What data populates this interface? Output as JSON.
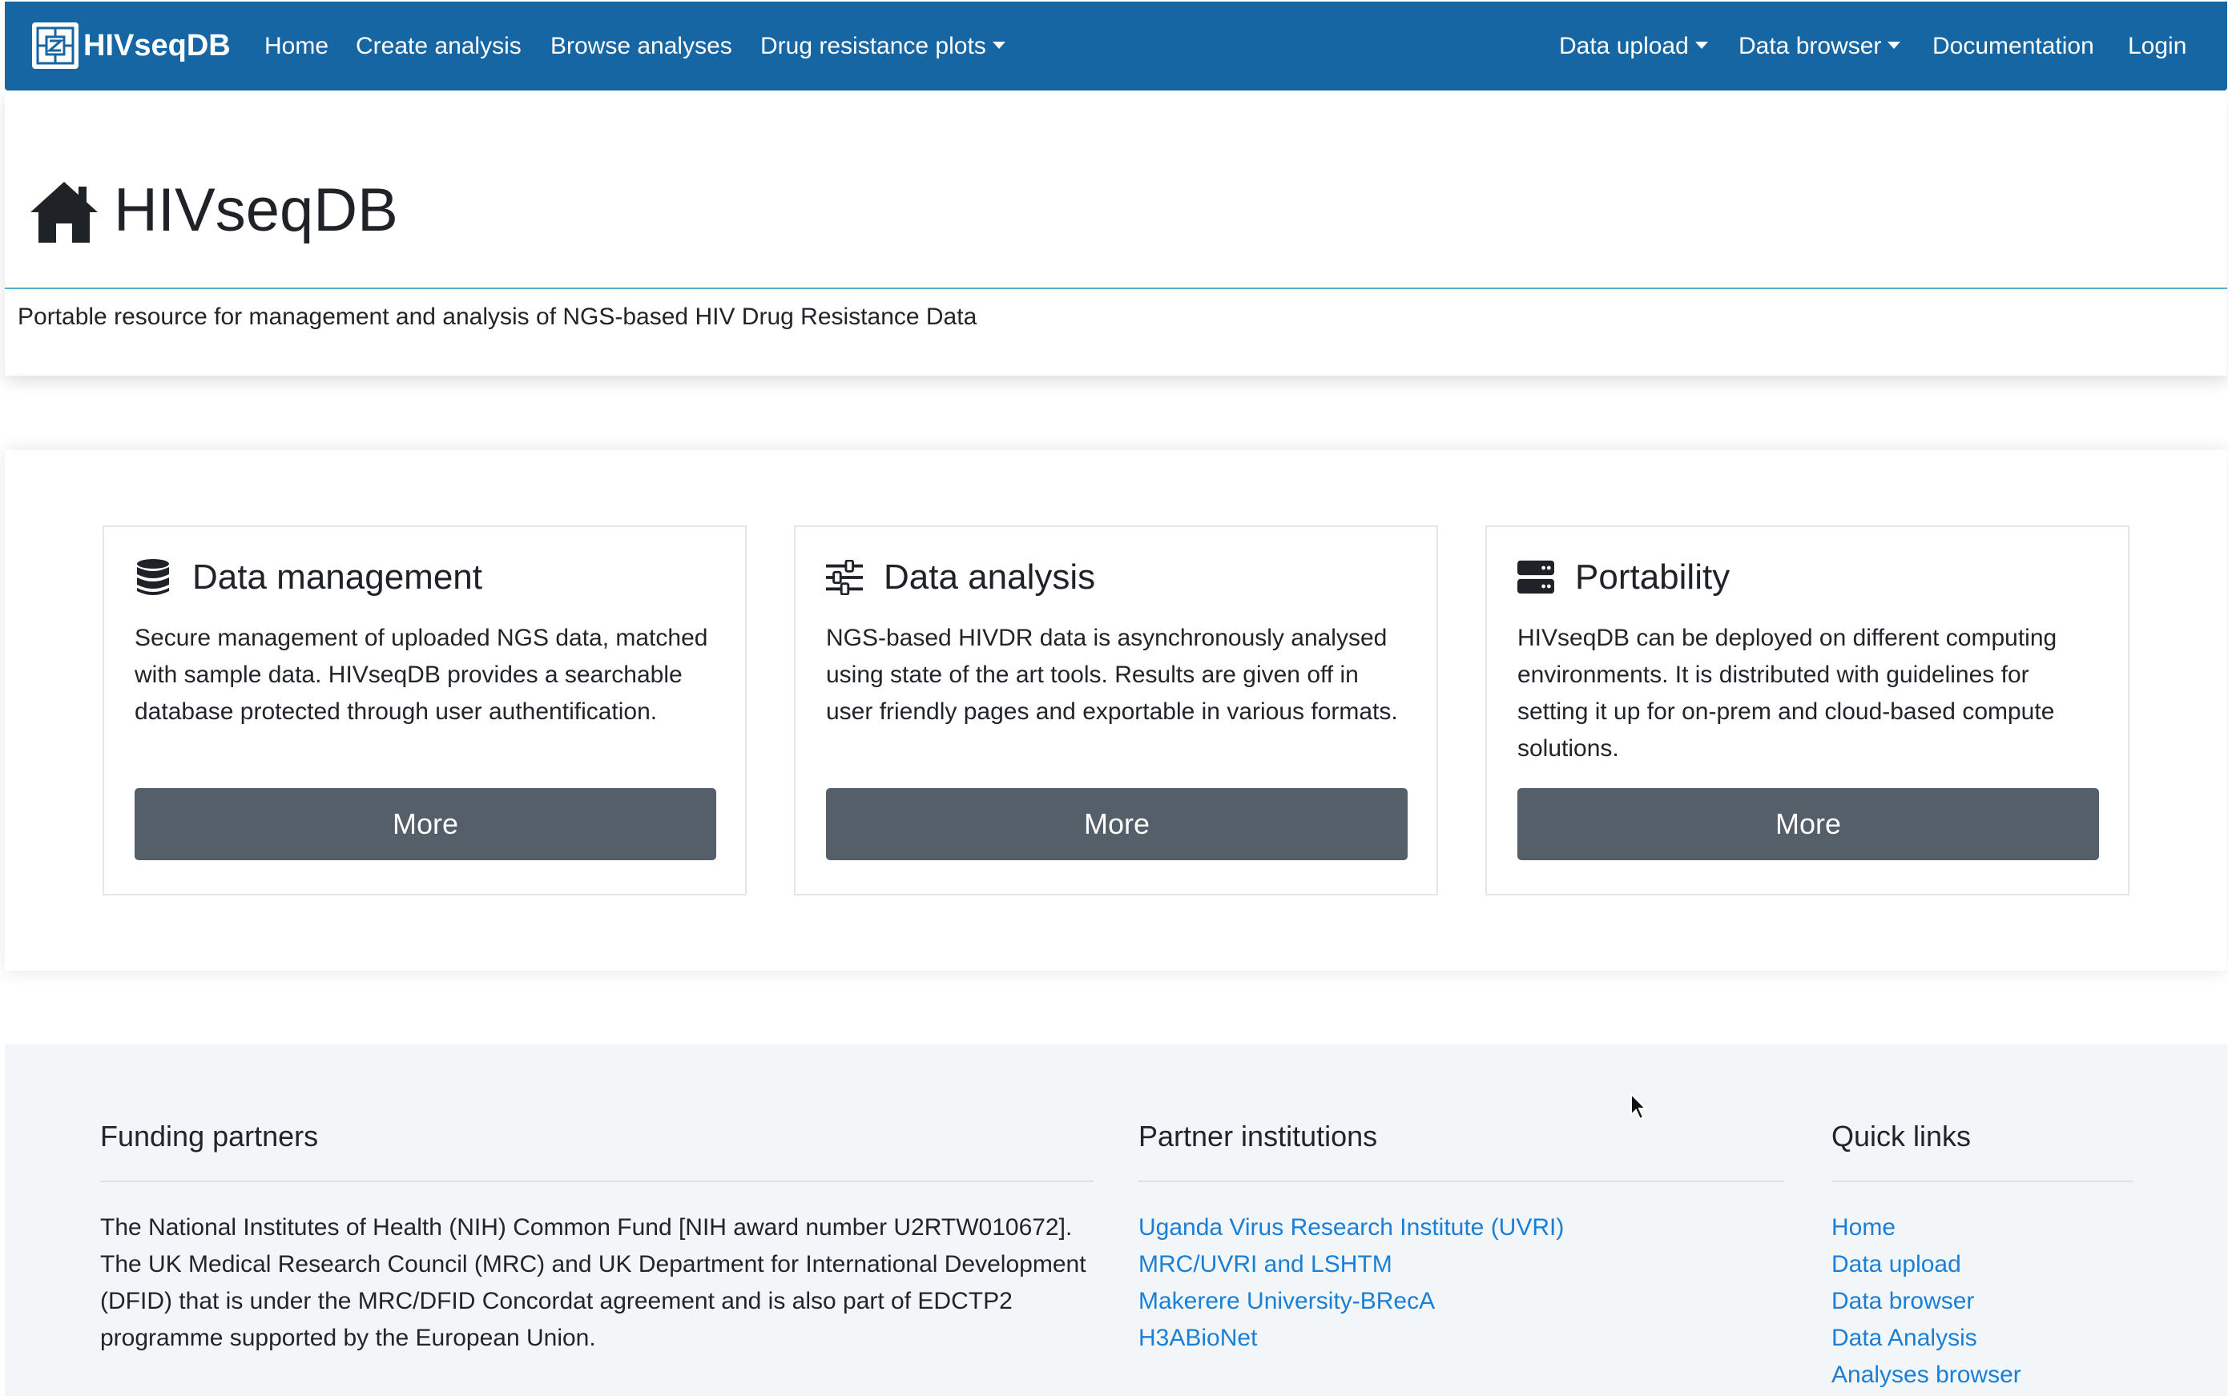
{
  "navbar": {
    "brand": "HIVseqDB",
    "left_items": [
      "Home",
      "Create analysis",
      "Browse analyses",
      "Drug resistance plots"
    ],
    "right_items": [
      "Data upload",
      "Data browser",
      "Documentation",
      "Login"
    ],
    "bg_color": "#1766a4"
  },
  "header": {
    "icon": "home-icon",
    "title": "HIVseqDB",
    "subtitle": "Portable resource for management and analysis of NGS-based HIV Drug Resistance Data"
  },
  "features": [
    {
      "icon": "database-icon",
      "title": "Data management",
      "text": "Secure management of uploaded NGS data, matched with sample data. HIVseqDB provides a searchable database protected through user authentification.",
      "button": "More"
    },
    {
      "icon": "sliders-icon",
      "title": "Data analysis",
      "text": "NGS-based HIVDR data is asynchronously analysed using state of the art tools. Results are given off in user friendly pages and exportable in various formats.",
      "button": "More"
    },
    {
      "icon": "server-icon",
      "title": "Portability",
      "text": "HIVseqDB can be deployed on different computing environments. It is distributed with guidelines for setting it up for on-prem and cloud-based compute solutions.",
      "button": "More"
    }
  ],
  "footer": {
    "funding": {
      "heading": "Funding partners",
      "text": "The National Institutes of Health (NIH) Common Fund [NIH award number U2RTW010672]. The UK Medical Research Council (MRC) and UK Department for International Development (DFID) that is under the MRC/DFID Concordat agreement and is also part of EDCTP2 programme supported by the European Union."
    },
    "partners": {
      "heading": "Partner institutions",
      "links": [
        "Uganda Virus Research Institute (UVRI)",
        "MRC/UVRI and LSHTM",
        "Makerere University-BRecA",
        "H3ABioNet"
      ]
    },
    "quick_links": {
      "heading": "Quick links",
      "links": [
        "Home",
        "Data upload",
        "Data browser",
        "Data Analysis",
        "Analyses browser"
      ]
    },
    "link_color": "#1a7fd6"
  }
}
